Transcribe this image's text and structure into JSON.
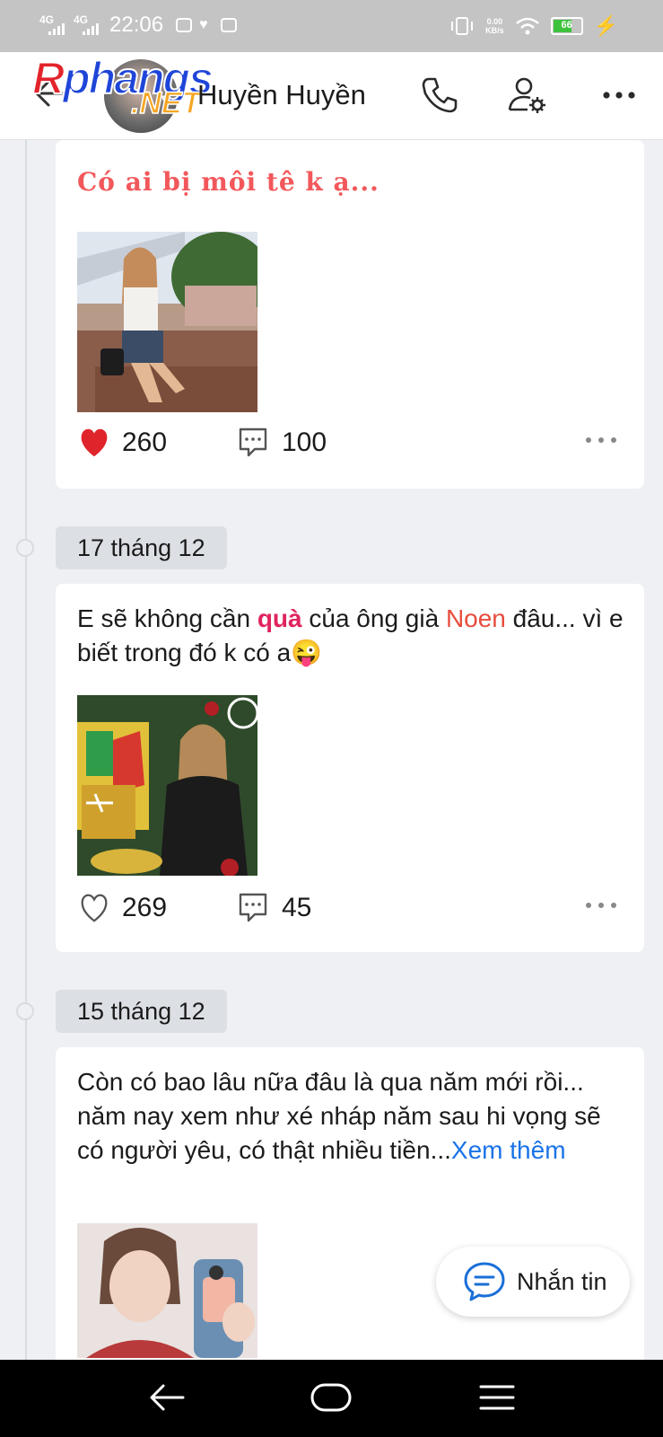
{
  "status_bar": {
    "signal_1": "4G",
    "signal_2": "4G",
    "time": "22:06",
    "net_speed_value": "0.00",
    "net_speed_unit": "KB/s",
    "battery_level": "66"
  },
  "header": {
    "contact_name": "Huyền Huyền",
    "watermark_line1_red": "R",
    "watermark_line1": "phangs",
    "watermark_line2": ".NET"
  },
  "posts": [
    {
      "title": "Có ai bị môi tê k ạ...",
      "likes": "260",
      "comments": "100",
      "liked": true
    },
    {
      "date": "17 tháng 12",
      "text_part1": "E sẽ không cần ",
      "text_highlight1": "quà",
      "text_part2": " của ông già ",
      "text_highlight2": "Noen",
      "text_part3": " đâu... vì e biết trong đó k có a",
      "emoji": "😜",
      "likes": "269",
      "comments": "45",
      "liked": false
    },
    {
      "date": "15 tháng 12",
      "text": "Còn có bao lâu nữa đâu là qua năm mới rồi... năm nay xem như xé nháp năm sau hi vọng sẽ có người yêu, có thật nhiều tiền...",
      "see_more": "Xem thêm"
    }
  ],
  "message_button": {
    "label": "Nhắn tin"
  },
  "colors": {
    "like_red": "#e0242b",
    "title_coral": "#f2585b",
    "highlight_pink": "#e0245e",
    "link_blue": "#1a73e8"
  }
}
